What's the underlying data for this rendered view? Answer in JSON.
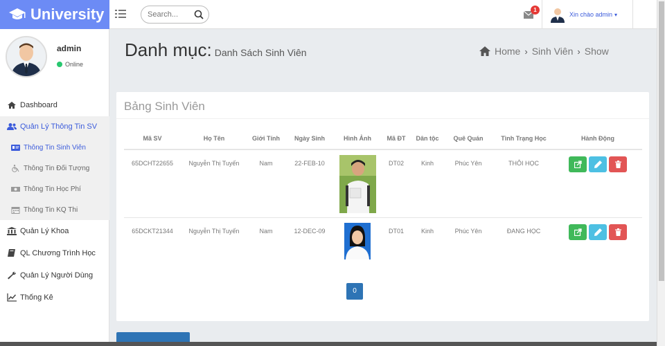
{
  "brand": {
    "name": "University"
  },
  "search": {
    "placeholder": "Search..."
  },
  "header": {
    "mail_count": "1",
    "greeting": "Xin chào admin",
    "caret": "▾"
  },
  "profile": {
    "name": "admin",
    "status": "Online"
  },
  "sidebar": {
    "items": [
      {
        "label": "Dashboard",
        "icon": "home-icon"
      },
      {
        "label": "Quản Lý Thông Tin SV",
        "icon": "users-icon",
        "active": true
      },
      {
        "label": "Quản Lý Khoa",
        "icon": "bank-icon"
      },
      {
        "label": "QL Chương Trình Học",
        "icon": "book-icon"
      },
      {
        "label": "Quản Lý Người Dùng",
        "icon": "wrench-icon"
      },
      {
        "label": "Thống Kê",
        "icon": "line-chart-icon"
      }
    ],
    "subitems": [
      {
        "label": "Thông Tin Sinh Viên",
        "icon": "id-card-icon",
        "current": true
      },
      {
        "label": "Thông Tin Đối Tượng",
        "icon": "wheelchair-icon"
      },
      {
        "label": "Thông Tin Học Phí",
        "icon": "money-icon"
      },
      {
        "label": "Thông Tin KQ Thi",
        "icon": "calendar-icon"
      }
    ]
  },
  "page": {
    "title": "Danh mục:",
    "subtitle": "Danh Sách Sinh Viên"
  },
  "breadcrumb": {
    "home": "Home",
    "section": "Sinh Viên",
    "current": "Show",
    "sep": "›"
  },
  "panel": {
    "title": "Bảng Sinh Viên"
  },
  "table": {
    "headers": [
      "Mã SV",
      "Họ Tên",
      "Giới Tính",
      "Ngày Sinh",
      "Hình Ảnh",
      "Mã ĐT",
      "Dân tộc",
      "Quê Quán",
      "Tình Trạng Học",
      "Hành Động"
    ],
    "rows": [
      {
        "ma_sv": "65DCHT22655",
        "ho_ten": "Nguyễn Thị Tuyến",
        "gioi_tinh": "Nam",
        "ngay_sinh": "22-FEB-10",
        "ma_dt": "DT02",
        "dan_toc": "Kinh",
        "que_quan": "Phúc Yên",
        "tinh_trang": "THÔI HỌC"
      },
      {
        "ma_sv": "65DCKT21344",
        "ho_ten": "Nguyễn Thị Tuyến",
        "gioi_tinh": "Nam",
        "ngay_sinh": "12-DEC-09",
        "ma_dt": "DT01",
        "dan_toc": "Kinh",
        "que_quan": "Phúc Yên",
        "tinh_trang": "ĐANG HỌC"
      }
    ]
  },
  "pagination": {
    "current": "0"
  },
  "colors": {
    "brand": "#6c8bf5",
    "link": "#3b5bdb",
    "primary": "#2e74b5",
    "success": "#40b95a",
    "info": "#4dc0e3",
    "danger": "#e25555"
  }
}
